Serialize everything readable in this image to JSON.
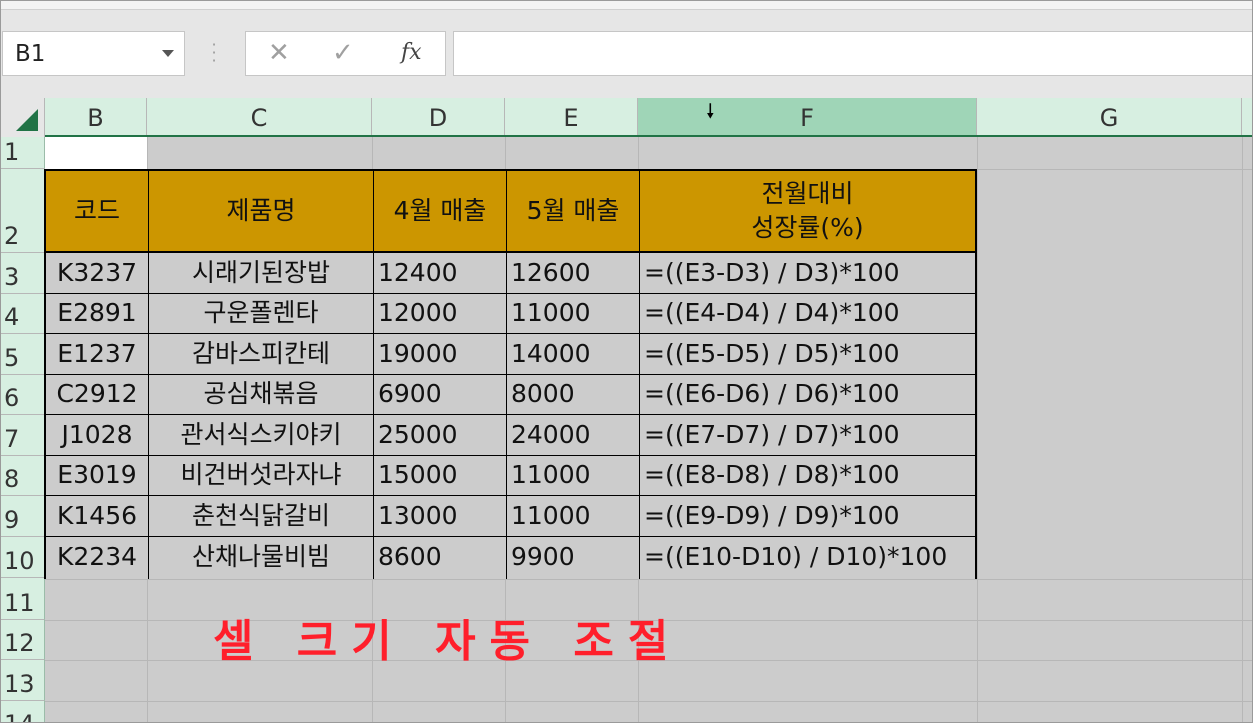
{
  "name_box": {
    "value": "B1"
  },
  "formula_bar": {
    "cancel_icon": "✕",
    "enter_icon": "✓",
    "fx_label": "fx",
    "formula": ""
  },
  "columns": [
    "B",
    "C",
    "D",
    "E",
    "F",
    "G"
  ],
  "rows": [
    "1",
    "2",
    "3",
    "4",
    "5",
    "6",
    "7",
    "8",
    "9",
    "10",
    "11",
    "12",
    "13",
    "14"
  ],
  "selected_column": "F",
  "table": {
    "header": [
      "코드",
      "제품명",
      "4월 매출",
      "5월 매출",
      "전월대비",
      "성장률(%)"
    ],
    "rows": [
      [
        "K3237",
        "시래기된장밥",
        "12400",
        "12600",
        "=((E3-D3) / D3)*100"
      ],
      [
        "E2891",
        "구운폴렌타",
        "12000",
        "11000",
        "=((E4-D4) / D4)*100"
      ],
      [
        "E1237",
        "감바스피칸테",
        "19000",
        "14000",
        "=((E5-D5) / D5)*100"
      ],
      [
        "C2912",
        "공심채볶음",
        "6900",
        "8000",
        "=((E6-D6) / D6)*100"
      ],
      [
        "J1028",
        "관서식스키야키",
        "25000",
        "24000",
        "=((E7-D7) / D7)*100"
      ],
      [
        "E3019",
        "비건버섯라자냐",
        "15000",
        "11000",
        "=((E8-D8) / D8)*100"
      ],
      [
        "K1456",
        "춘천식닭갈비",
        "13000",
        "11000",
        "=((E9-D9) / D9)*100"
      ],
      [
        "K2234",
        "산채나물비빔",
        "8600",
        "9900",
        "=((E10-D10) / D10)*100"
      ]
    ],
    "header_color": "#cc9600"
  },
  "banner": {
    "text": "셀 크기 자동 조절",
    "color": "#ff1f2b"
  },
  "accent_color": "#217346"
}
